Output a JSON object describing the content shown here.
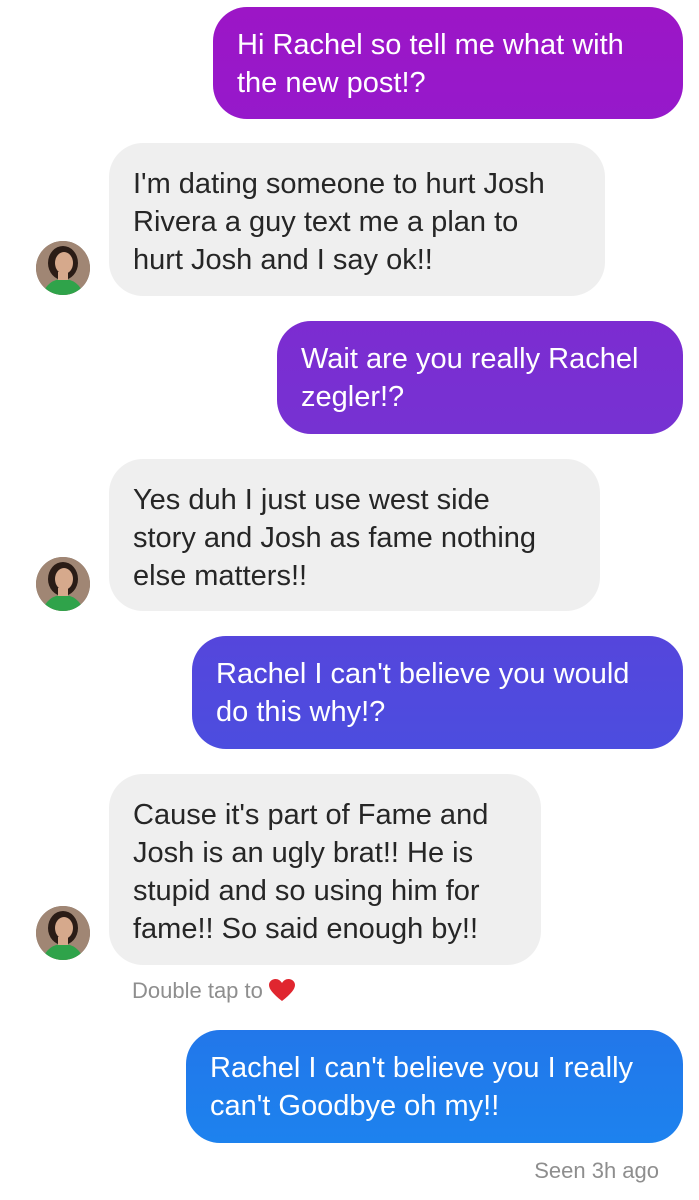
{
  "thread": {
    "messages": [
      {
        "direction": "sent",
        "text": "Hi Rachel so tell me what with\nthe new post!?",
        "color": "#9a17c8"
      },
      {
        "direction": "received",
        "text": "I'm dating someone to hurt Josh\nRivera a guy text me a plan to\nhurt Josh and I say ok!!"
      },
      {
        "direction": "sent",
        "text": "Wait are you really Rachel\nzegler!?",
        "color": "#7a2fd0"
      },
      {
        "direction": "received",
        "text": "Yes duh I just use west side\nstory and Josh as fame nothing\nelse matters!!"
      },
      {
        "direction": "sent",
        "text": "Rachel I can't believe you would\ndo this why!?",
        "color": "#5149dd"
      },
      {
        "direction": "received",
        "text": "Cause it's part of Fame and\nJosh is an ugly brat!! He is\nstupid and so using him for\nfame!! So said enough by!!"
      },
      {
        "direction": "sent",
        "text": "Rachel I can't believe you I really\ncan't Goodbye oh my!!",
        "color": "#1f7ded"
      }
    ],
    "double_tap_hint": "Double tap to",
    "hint_icon": "heart-icon",
    "heart_color": "#e0262f",
    "seen_status": "Seen 3h ago"
  }
}
